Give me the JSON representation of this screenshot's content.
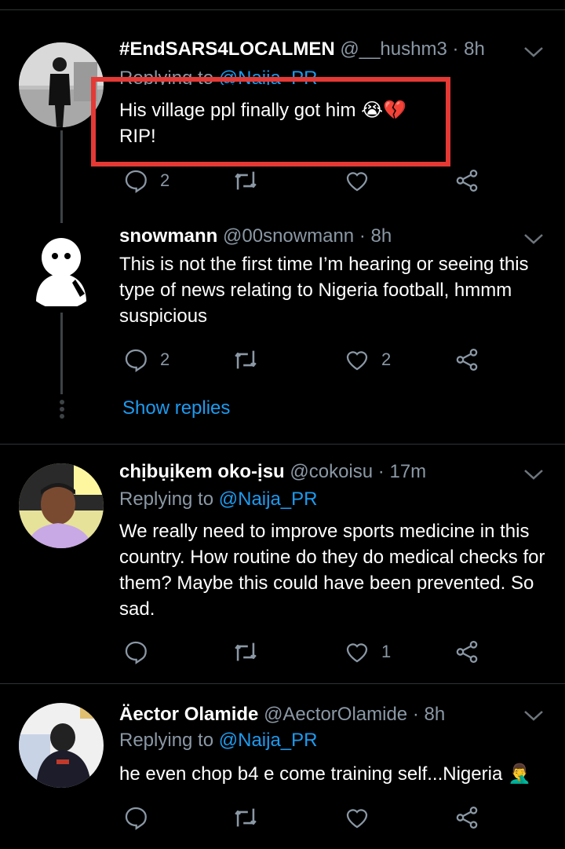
{
  "tweets": [
    {
      "name": "#EndSARS4LOCALMEN",
      "handle": "@__hushm3",
      "time": "8h",
      "replying_prefix": "Replying to",
      "replying_to": "@Naija_PR",
      "text_line1": "His village ppl finally got him 😭💔",
      "text_line2": "RIP!",
      "replies": "2",
      "retweets": "",
      "likes": ""
    },
    {
      "name": "snowmann",
      "handle": "@00snowmann",
      "time": "8h",
      "text": "This is not the first time I’m hearing or seeing this type of news relating to Nigeria football, hmmm suspicious",
      "replies": "2",
      "retweets": "",
      "likes": "2",
      "show_replies": "Show replies"
    },
    {
      "name": "chịbụịkem oko-ịsu",
      "handle": "@cokoisu",
      "time": "17m",
      "replying_prefix": "Replying to",
      "replying_to": "@Naija_PR",
      "text": "We really need to improve sports medicine in this country. How routine do they do medical checks for them? Maybe this could have been prevented. So sad.",
      "replies": "",
      "retweets": "",
      "likes": "1"
    },
    {
      "name": "Äector Olamide",
      "handle": "@AectorOlamide",
      "time": "8h",
      "replying_prefix": "Replying to",
      "replying_to": "@Naija_PR",
      "text": "he even chop b4 e come training self...Nigeria 🤦‍♂️",
      "replies": "",
      "retweets": "",
      "likes": ""
    }
  ],
  "colors": {
    "link": "#1d9bf0",
    "secondary_text": "#8b98a5",
    "highlight_border": "#e53935",
    "background": "#000000"
  },
  "icons": [
    "reply-icon",
    "retweet-icon",
    "like-icon",
    "share-icon",
    "chevron-down-icon"
  ]
}
